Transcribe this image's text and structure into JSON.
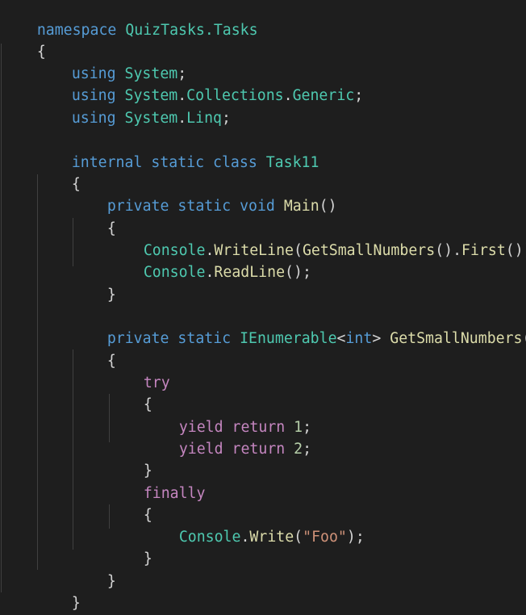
{
  "editor": {
    "theme_colors": {
      "background": "#1e1e1e",
      "keyword": "#569cd6",
      "control_keyword": "#c586c0",
      "type": "#4ec9b0",
      "method": "#dcdcaa",
      "number": "#b5cea8",
      "string": "#ce9178",
      "punctuation": "#d4d4d4"
    },
    "code": {
      "namespace_kw": "namespace",
      "namespace_name": "QuizTasks.Tasks",
      "open_brace": "{",
      "close_brace": "}",
      "using_kw": "using",
      "using1": "System",
      "using2_ns1": "System",
      "using2_ns2": "Collections",
      "using2_ns3": "Generic",
      "using3_ns1": "System",
      "using3_ns2": "Linq",
      "semicolon": ";",
      "dot": ".",
      "internal_kw": "internal",
      "static_kw": "static",
      "class_kw": "class",
      "class_name": "Task11",
      "private_kw": "private",
      "void_kw": "void",
      "main_name": "Main",
      "parens": "()",
      "console": "Console",
      "writeline": "WriteLine",
      "getsmall": "GetSmallNumbers",
      "first": "First",
      "readline": "ReadLine",
      "ienumerable": "IEnumerable",
      "int_kw": "int",
      "try_kw": "try",
      "yield_kw": "yield",
      "return_kw": "return",
      "num1": "1",
      "num2": "2",
      "finally_kw": "finally",
      "write": "Write",
      "foo_str": "\"Foo\""
    }
  }
}
